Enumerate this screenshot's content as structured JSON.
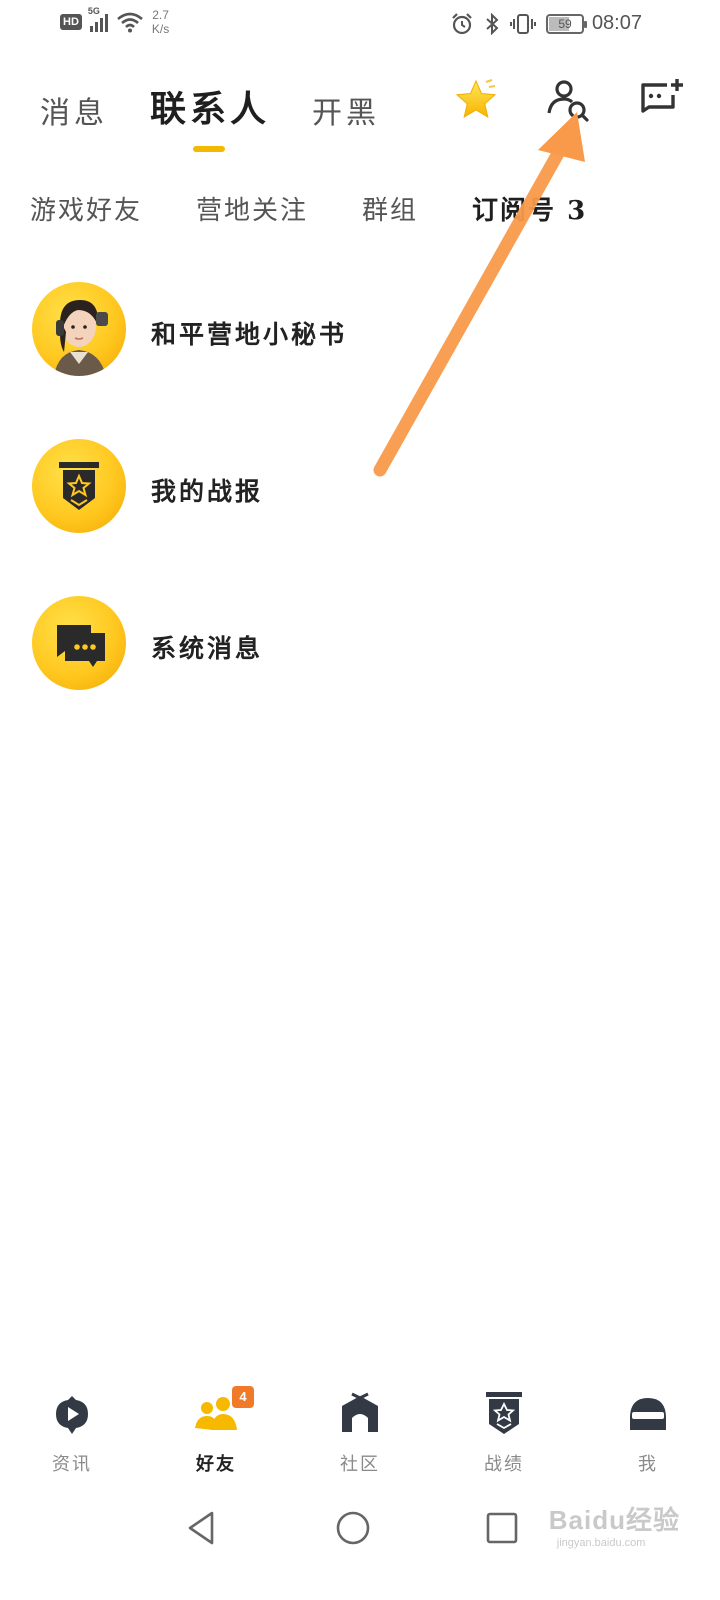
{
  "status_bar": {
    "hd": "HD",
    "network": "5G",
    "speed_value": "2.7",
    "speed_unit": "K/s",
    "battery": "59",
    "battery_level": 0.59,
    "time": "08:07"
  },
  "top_tabs": [
    {
      "label": "消息",
      "active": false
    },
    {
      "label": "联系人",
      "active": true
    },
    {
      "label": "开黑",
      "active": false
    }
  ],
  "top_icons": [
    "star-icon",
    "find-friend-icon",
    "new-chat-icon"
  ],
  "sub_tabs": [
    {
      "label": "游戏好友",
      "active": false
    },
    {
      "label": "营地关注",
      "active": false
    },
    {
      "label": "群组",
      "active": false
    },
    {
      "label": "订阅号 3",
      "active": true
    }
  ],
  "contacts": [
    {
      "name": "和平营地小秘书",
      "icon": "secretary-avatar"
    },
    {
      "name": "我的战报",
      "icon": "badge-icon"
    },
    {
      "name": "系统消息",
      "icon": "message-icon"
    }
  ],
  "bottom_nav": [
    {
      "label": "资讯",
      "icon": "news-icon",
      "active": false
    },
    {
      "label": "好友",
      "icon": "friends-icon",
      "active": true,
      "badge": "4"
    },
    {
      "label": "社区",
      "icon": "community-icon",
      "active": false
    },
    {
      "label": "战绩",
      "icon": "record-icon",
      "active": false
    },
    {
      "label": "我",
      "icon": "me-icon",
      "active": false
    }
  ],
  "watermark": {
    "main": "Baidu经验",
    "sub": "jingyan.baidu.com"
  },
  "colors": {
    "accent": "#f5b800",
    "badge": "#f07a28",
    "arrow": "#f89a4a"
  }
}
